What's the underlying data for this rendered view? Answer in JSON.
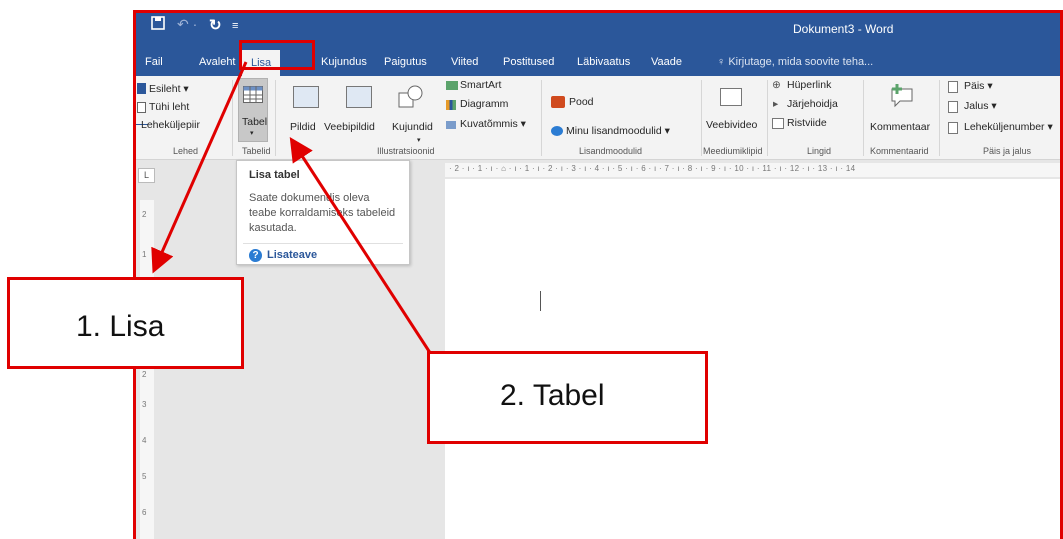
{
  "window": {
    "title": "Dokument3 - Word"
  },
  "tabs": [
    "Fail",
    "Avaleht",
    "Lisa",
    "Kujundus",
    "Paigutus",
    "Viited",
    "Postitused",
    "Läbivaatus",
    "Vaade"
  ],
  "active_tab": "Lisa",
  "tell_me": "Kirjutage, mida soovite teha...",
  "ribbon": {
    "lehed": {
      "items": [
        "Esileht",
        "Tühi leht",
        "Leheküljepiir"
      ],
      "label": "Lehed"
    },
    "tabelid": {
      "table_button": "Tabel",
      "label": "Tabelid"
    },
    "illustratsioonid": {
      "items": [
        "Pildid",
        "Veebipildid",
        "Kujundid",
        "SmartArt",
        "Diagramm",
        "Kuvatõmmis"
      ],
      "label": "Illustratsioonid"
    },
    "lisandmoodulid": {
      "items": [
        "Pood",
        "Minu lisandmoodulid"
      ],
      "label": "Lisandmoodulid"
    },
    "meedium": {
      "items": [
        "Veebivideo"
      ],
      "label": "Meediumiklipid"
    },
    "lingid": {
      "items": [
        "Hüperlink",
        "Järjehoidja",
        "Ristviide"
      ],
      "label": "Lingid"
    },
    "kommentaarid": {
      "items": [
        "Kommentaar"
      ],
      "label": "Kommentaarid"
    },
    "pais": {
      "items": [
        "Päis",
        "Jalus",
        "Leheküljenumber"
      ],
      "label": "Päis ja jalus"
    }
  },
  "ruler_text": "· 2 · ı · 1 · ı ·  ⌂  · ı · 1 · ı · 2 · ı · 3 · ı · 4 · ı · 5 · ı · 6 · ı · 7 · ı · 8 · ı · 9 · ı · 10 · ı · 11 · ı · 12 · ı · 13 · ı · 14",
  "ruler_corner": "L",
  "vertical_ruler": [
    "2",
    "1",
    "1",
    "2",
    "3",
    "4",
    "5",
    "6"
  ],
  "tooltip": {
    "title": "Lisa tabel",
    "body": "Saate dokumendis oleva teabe korraldamiseks tabeleid kasutada.",
    "link": "Lisateave"
  },
  "annotations": {
    "step1": "1. Lisa",
    "step2": "2. Tabel"
  },
  "colors": {
    "accent": "#2b579a",
    "annotation": "#e00000"
  }
}
